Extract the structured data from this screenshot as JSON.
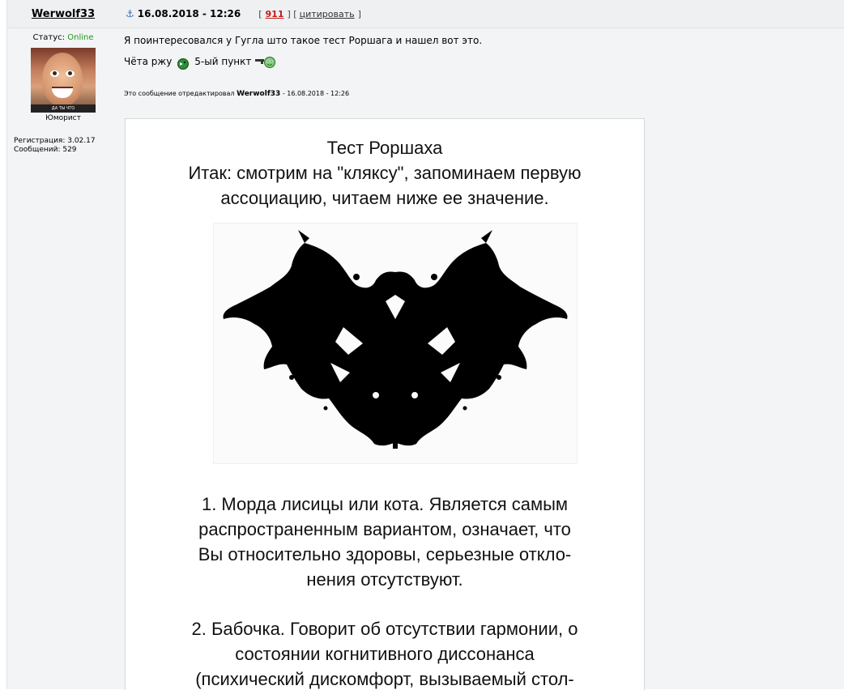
{
  "user": {
    "name": "Werwolf33",
    "status_label": "Статус:",
    "status_value": "Online",
    "avatar_caption": "ДА ТЫ ЧТО",
    "rank": "Юморист",
    "registration": "Регистрация: 3.02.17",
    "messages": "Сообщений: 529"
  },
  "post": {
    "date": "16.08.2018 - 12:26",
    "bracket_open": "[",
    "post_number": "911",
    "bracket_mid": "] [",
    "quote_label": "цитировать",
    "bracket_close": "]",
    "line1": "Я поинтересовался у Гугла што такое тест Роршага и нашел вот это.",
    "line2_a": "Чёта ржу",
    "line2_b": "5-ый пункт",
    "edited_prefix": "Это сообщение отредактировал",
    "edited_user": "Werwolf33",
    "edited_suffix": "- 16.08.2018 - 12:26"
  },
  "image": {
    "title_lines": [
      "Тест Роршаха",
      "Итак: смотрим на \"кляксу\", запоминаем первую",
      "ассоциацию, читаем ниже ее значение."
    ],
    "item1_lines": [
      "1. Морда лисицы или кота. Является самым",
      "распространенным вариантом, означает, что",
      "Вы относительно здоровы, серьезные откло-",
      "нения отсутствуют."
    ],
    "item2_lines": [
      "2. Бабочка. Говорит об отсутствии гармонии, о",
      "состоянии когнитивного диссонанса",
      "(психический дискомфорт, вызываемый стол-"
    ]
  },
  "colors": {
    "online": "#1c9a1c",
    "post_number": "#c41a1a",
    "anchor": "#2b6fb6",
    "panel": "#f2f4f5"
  },
  "icons": [
    "anchor-icon",
    "smiley-laugh-icon",
    "smiley-gun-icon"
  ]
}
